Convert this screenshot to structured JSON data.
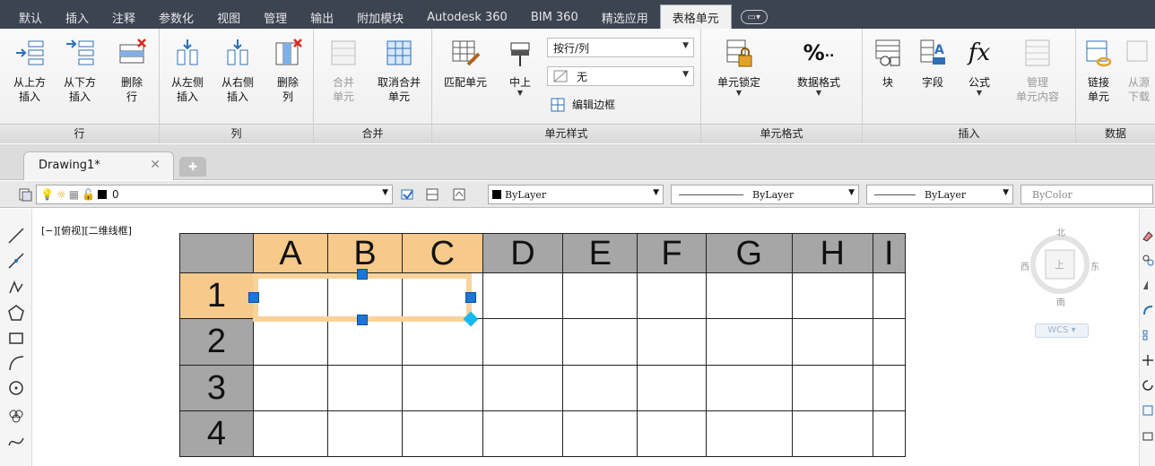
{
  "ribbon_tabs": [
    {
      "label": "默认",
      "active": false
    },
    {
      "label": "插入",
      "active": false
    },
    {
      "label": "注释",
      "active": false
    },
    {
      "label": "参数化",
      "active": false
    },
    {
      "label": "视图",
      "active": false
    },
    {
      "label": "管理",
      "active": false
    },
    {
      "label": "输出",
      "active": false
    },
    {
      "label": "附加模块",
      "active": false
    },
    {
      "label": "Autodesk 360",
      "active": false
    },
    {
      "label": "BIM 360",
      "active": false
    },
    {
      "label": "精选应用",
      "active": false
    },
    {
      "label": "表格单元",
      "active": true
    }
  ],
  "panels": {
    "rows": {
      "title": "行",
      "insert_above": {
        "l1": "从上方",
        "l2": "插入"
      },
      "insert_below": {
        "l1": "从下方",
        "l2": "插入"
      },
      "delete_row": {
        "l1": "删除",
        "l2": "行"
      }
    },
    "cols": {
      "title": "列",
      "insert_left": {
        "l1": "从左侧",
        "l2": "插入"
      },
      "insert_right": {
        "l1": "从右侧",
        "l2": "插入"
      },
      "delete_col": {
        "l1": "删除",
        "l2": "列"
      }
    },
    "merge": {
      "title": "合并",
      "merge_cells": {
        "l1": "合并",
        "l2": "单元"
      },
      "unmerge": {
        "l1": "取消合并",
        "l2": "单元"
      }
    },
    "cell_style": {
      "title": "单元样式",
      "match_cell": "匹配单元",
      "align": "中上",
      "style_dropdown": "按行/列",
      "fill_dropdown": "无",
      "edit_borders": "编辑边框"
    },
    "cell_format": {
      "title": "单元格式",
      "cell_lock": "单元锁定",
      "data_format": "数据格式"
    },
    "insert": {
      "title": "插入",
      "block": "块",
      "field": "字段",
      "formula": "公式",
      "manage": {
        "l1": "管理",
        "l2": "单元内容"
      }
    },
    "data": {
      "title": "数据",
      "link": {
        "l1": "链接",
        "l2": "单元"
      },
      "download": {
        "l1": "从源",
        "l2": "下载"
      }
    }
  },
  "file_tab": {
    "name": "Drawing1*"
  },
  "layer_bar": {
    "layer": "0",
    "color": "ByLayer",
    "linetype": "ByLayer",
    "lineweight": "ByLayer",
    "plotstyle": "ByColor"
  },
  "viewport_label": "[−][俯视][二维线框]",
  "table": {
    "columns": [
      "A",
      "B",
      "C",
      "D",
      "E",
      "F",
      "G",
      "H",
      "I"
    ],
    "rows": [
      "1",
      "2",
      "3",
      "4"
    ],
    "selected_columns": [
      "A",
      "B",
      "C"
    ],
    "selected_row": "1"
  },
  "viewcube": {
    "north": "北",
    "south": "南",
    "east": "东",
    "west": "西",
    "face": "上",
    "wcs": "WCS"
  },
  "colors": {
    "selection": "#f7c98a",
    "grip": "#1c75d8",
    "header": "#a6a6a6"
  }
}
